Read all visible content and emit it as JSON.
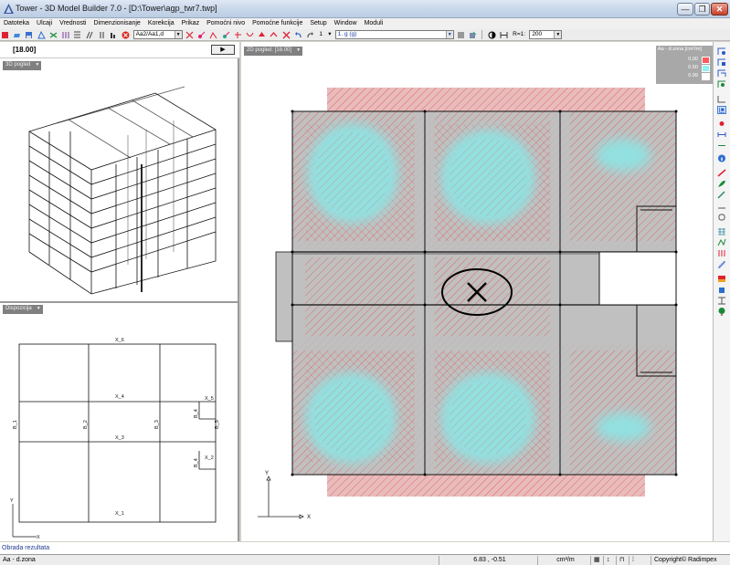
{
  "window": {
    "title": "Tower - 3D Model Builder 7.0 - [D:\\Tower\\agp_twr7.twp]",
    "minimize": "—",
    "maximize": "❐",
    "close": "✕"
  },
  "menu": [
    "Datoteka",
    "Ulcaji",
    "Vrednosti",
    "Dimenzionisanje",
    "Korekcija",
    "Prikaz",
    "Pomoćni nivo",
    "Pomoćne funkcije",
    "Setup",
    "Window",
    "Moduli"
  ],
  "toolbar": {
    "result_combo": "Aa2/Aa1,d",
    "level_number": "1",
    "load_case_combo": "1. g (g)",
    "ratio_label": "R=1:",
    "scale_combo": "200"
  },
  "left": {
    "level_label": "[18.00]",
    "play_label": "▶",
    "view3d_label": "3D pogled",
    "disp_label": "Dispozicija",
    "axes": {
      "x": "x",
      "y": "y",
      "z": "z"
    },
    "labels": {
      "x6": "X_6",
      "x5": "X_5",
      "x4": "X_4",
      "x3": "X_3",
      "x2": "X_2",
      "x1": "X_1",
      "b1": "B_1",
      "b2": "B_2",
      "b3": "B_3",
      "b4a": "B_4",
      "b4b": "B_4",
      "b5": "B_5",
      "dx": "X",
      "dy": "Y"
    }
  },
  "main": {
    "view_label": "2D pogled: [18.00]",
    "axis_x": "X",
    "axis_y": "Y",
    "legend": {
      "title": "Aa - d.zona [cm²/m]",
      "v1": "0.00",
      "v2": "0.50",
      "v3": "0.99",
      "c1": "#ff5a5a",
      "c2": "#8ff2f2",
      "c3": "#ffffff"
    },
    "colors": {
      "slab": "#c0c0c0",
      "hatch": "#e64c4c",
      "cyan": "#93e0e0"
    }
  },
  "status": {
    "note": "Obrada rezultata",
    "mode": "Aa - d.zona",
    "coords": "6.83 , -0.51",
    "unit": "cm²/m",
    "copyright": "Copyright© Radimpex"
  }
}
